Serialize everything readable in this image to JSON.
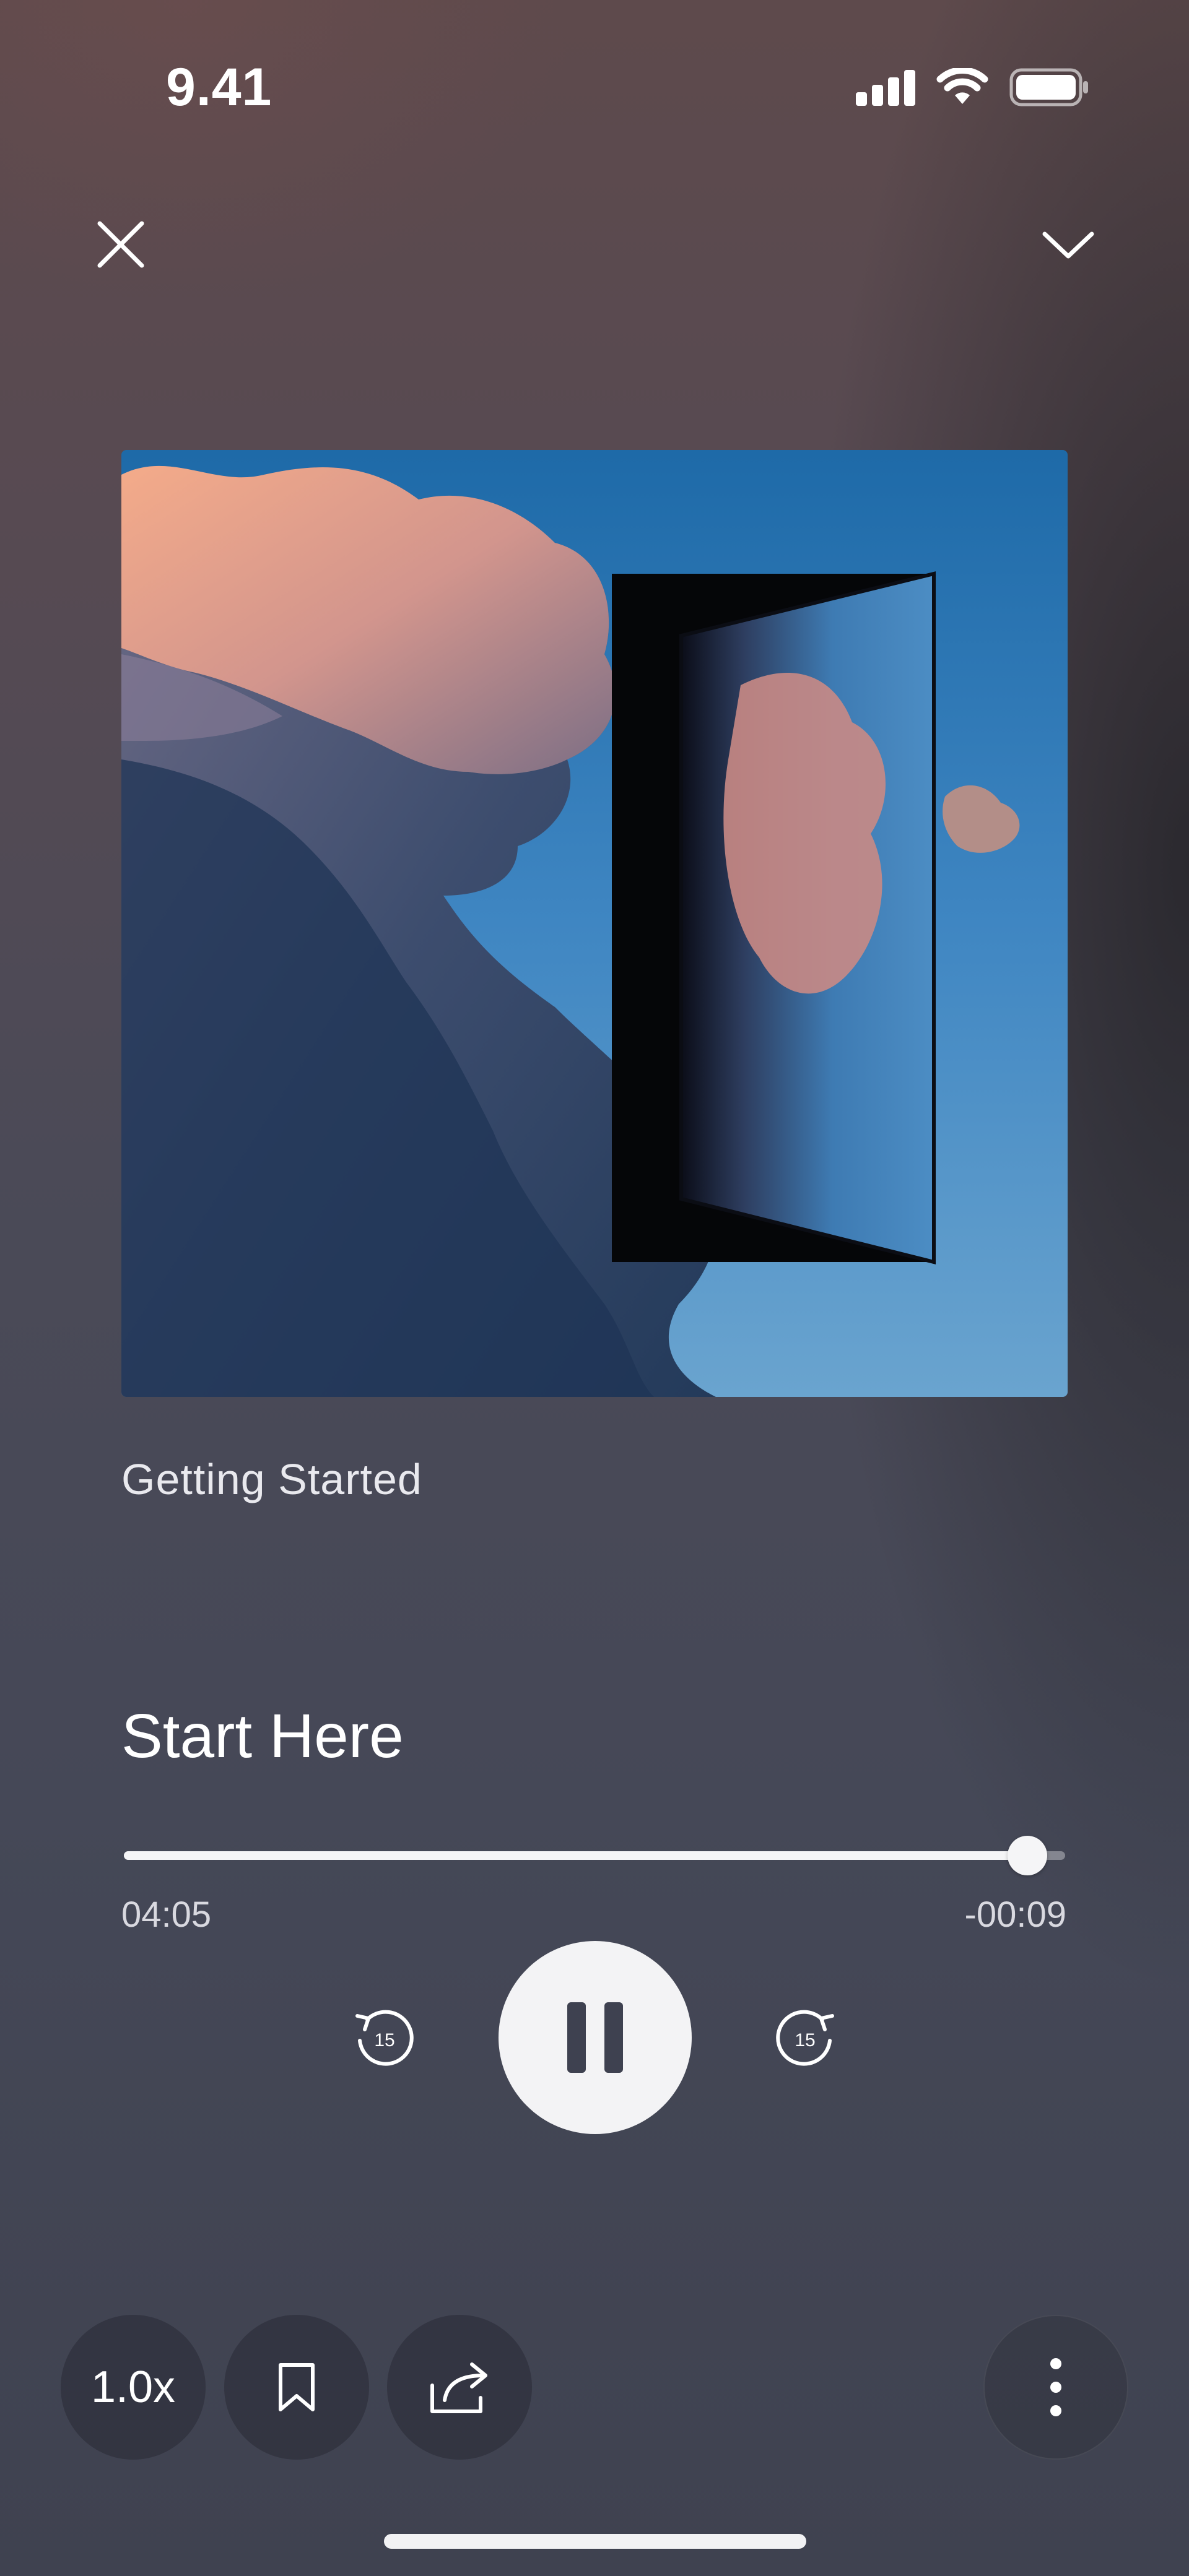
{
  "status_bar": {
    "time": "9.41",
    "icons": [
      "cellular-signal-icon",
      "wifi-icon",
      "battery-icon"
    ]
  },
  "header": {
    "close_icon": "close-icon",
    "collapse_icon": "chevron-down-icon"
  },
  "episode": {
    "collection": "Getting Started",
    "title": "Start Here",
    "artwork": "clouds-with-open-door"
  },
  "playback": {
    "elapsed": "04:05",
    "remaining": "-00:09",
    "progress_fraction": 0.96,
    "state": "playing",
    "skip_back_seconds": "15",
    "skip_forward_seconds": "15"
  },
  "actions": {
    "speed_label": "1.0x",
    "bookmark_icon": "bookmark-icon",
    "share_icon": "share-icon",
    "more_icon": "more-vertical-icon"
  },
  "colors": {
    "accent": "#f3f3f5",
    "background_top": "#5e4a4c",
    "background_bottom": "#3f4250"
  }
}
